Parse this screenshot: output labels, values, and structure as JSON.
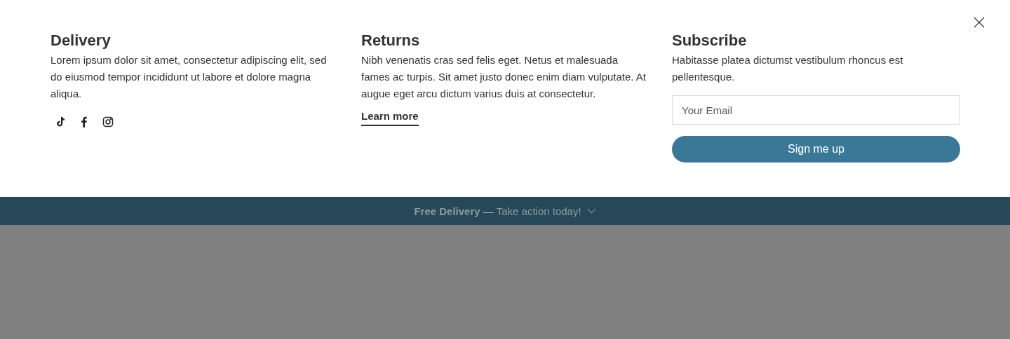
{
  "columns": [
    {
      "kind": "social",
      "title": "Delivery",
      "text": "Lorem ipsum dolor sit amet, consectetur adipiscing elit, sed do eiusmod tempor incididunt ut labore et dolore magna aliqua."
    },
    {
      "kind": "link",
      "title": "Returns",
      "text": "Nibh venenatis cras sed felis eget. Netus et malesuada fames ac turpis. Sit amet justo donec enim diam vulputate. At augue eget arcu dictum varius duis at consectetur.",
      "link": "Learn more"
    },
    {
      "kind": "subscribe",
      "title": "Subscribe",
      "text": "Habitasse platea dictumst vestibulum rhoncus est pellentesque.",
      "placeholder": "Your Email",
      "button": "Sign me up"
    }
  ],
  "banner": {
    "text": "**Free Delivery** — Take action today!"
  }
}
